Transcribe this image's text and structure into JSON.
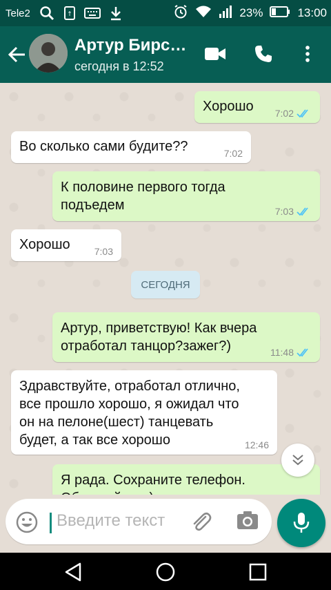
{
  "status_bar": {
    "carrier": "Tele2",
    "battery": "23%",
    "time": "13:00",
    "icons": [
      "search-icon",
      "sim-icon",
      "keyboard-icon",
      "download-icon",
      "alarm-icon",
      "wifi-icon",
      "signal-icon",
      "battery-icon"
    ]
  },
  "header": {
    "contact_name": "Артур Бирс…",
    "last_seen": "сегодня в 12:52",
    "icons": [
      "back-arrow-icon",
      "videocam-icon",
      "phone-icon",
      "more-vert-icon"
    ]
  },
  "colors": {
    "header": "#075e54",
    "status_bar": "#054d44",
    "incoming_bubble": "#ffffff",
    "outgoing_bubble": "#dcf8c6",
    "read_ticks": "#4fc3f7",
    "accent": "#00897b"
  },
  "messages": [
    {
      "direction": "out",
      "text": "Хорошо",
      "time": "7:02",
      "status": "read"
    },
    {
      "direction": "in",
      "text": "Во сколько сами будите??",
      "time": "7:02"
    },
    {
      "direction": "out",
      "text": "К половине первого тогда\nподъедем",
      "time": "7:03",
      "status": "read"
    },
    {
      "direction": "in",
      "text": "Хорошо",
      "time": "7:03"
    },
    {
      "direction": "out",
      "text": "Артур, приветствую! Как вчера\nотработал танцор?зажег?)",
      "time": "11:48",
      "status": "read"
    },
    {
      "direction": "in",
      "text": "Здравствуйте, отработал отлично,\nвсе прошло хорошо, я ожидал что\nон на пелоне(шест) танцевать\nбудет, а так все хорошо",
      "time": "12:46"
    },
    {
      "direction": "out",
      "text": "Я рада. Сохраните телефон.\nОбращайтесь)",
      "time": ""
    }
  ],
  "date_divider": "СЕГОДНЯ",
  "composer": {
    "placeholder": "Введите текст",
    "icons": [
      "emoji-icon",
      "attach-icon",
      "camera-icon",
      "mic-icon"
    ]
  },
  "nav_bar": {
    "icons": [
      "back-triangle-icon",
      "home-circle-icon",
      "recents-square-icon"
    ]
  }
}
